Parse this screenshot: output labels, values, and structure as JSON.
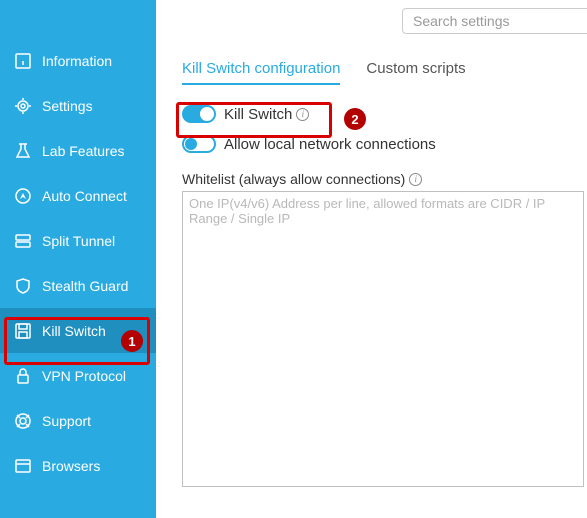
{
  "search": {
    "placeholder": "Search settings"
  },
  "sidebar": {
    "items": [
      {
        "label": "Information"
      },
      {
        "label": "Settings"
      },
      {
        "label": "Lab Features"
      },
      {
        "label": "Auto Connect"
      },
      {
        "label": "Split Tunnel"
      },
      {
        "label": "Stealth Guard"
      },
      {
        "label": "Kill Switch"
      },
      {
        "label": "VPN Protocol"
      },
      {
        "label": "Support"
      },
      {
        "label": "Browsers"
      }
    ]
  },
  "tabs": {
    "config": "Kill Switch configuration",
    "scripts": "Custom scripts"
  },
  "toggles": {
    "kill_switch": "Kill Switch",
    "allow_local": "Allow local network connections"
  },
  "whitelist": {
    "label": "Whitelist (always allow connections)",
    "placeholder": "One IP(v4/v6) Address per line, allowed formats are CIDR / IP Range / Single IP"
  },
  "callouts": {
    "one": "1",
    "two": "2"
  }
}
